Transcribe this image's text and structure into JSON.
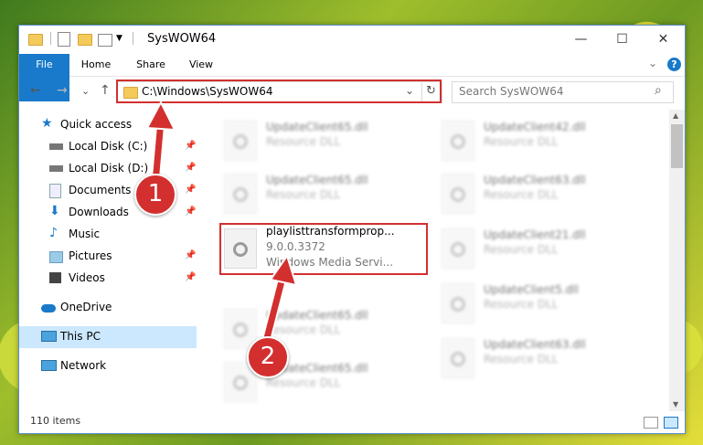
{
  "window": {
    "title": "SysWOW64",
    "minimize_label": "—",
    "maximize_label": "☐",
    "close_label": "✕"
  },
  "ribbon": {
    "tabs": [
      "File",
      "Home",
      "Share",
      "View"
    ],
    "help": "?",
    "collapse": "⌄"
  },
  "nav": {
    "back": "←",
    "forward": "→",
    "recent": "⌄",
    "up": "↑",
    "address": "C:\\Windows\\SysWOW64",
    "address_dropdown": "⌄",
    "refresh": "↻",
    "search_placeholder": "Search SysWOW64",
    "search_icon": "⌕"
  },
  "sidebar": {
    "items": [
      {
        "label": "Quick access",
        "icon": "star-icon"
      },
      {
        "label": "Local Disk (C:)",
        "icon": "drive-icon"
      },
      {
        "label": "Local Disk (D:)",
        "icon": "drive-icon"
      },
      {
        "label": "Documents",
        "icon": "documents-icon"
      },
      {
        "label": "Downloads",
        "icon": "download-icon"
      },
      {
        "label": "Music",
        "icon": "music-icon"
      },
      {
        "label": "Pictures",
        "icon": "pictures-icon"
      },
      {
        "label": "Videos",
        "icon": "videos-icon"
      },
      {
        "label": "OneDrive",
        "icon": "cloud-icon"
      },
      {
        "label": "This PC",
        "icon": "computer-icon"
      },
      {
        "label": "Network",
        "icon": "network-icon"
      }
    ]
  },
  "files": {
    "left": [
      {
        "name": "UpdateClient65.dll",
        "type": "Resource DLL"
      },
      {
        "name": "UpdateClient65.dll",
        "type": "Resource DLL"
      },
      {
        "name": "playlisttransformprop...",
        "version": "9.0.0.3372",
        "desc": "Windows Media Servi..."
      },
      {
        "name": "UpdateClient65.dll",
        "type": "Resource DLL"
      },
      {
        "name": "UpdateClient65.dll",
        "type": "Resource DLL"
      }
    ],
    "right": [
      {
        "name": "UpdateClient42.dll",
        "type": "Resource DLL"
      },
      {
        "name": "UpdateClient63.dll",
        "type": "Resource DLL"
      },
      {
        "name": "UpdateClient21.dll",
        "type": "Resource DLL"
      },
      {
        "name": "UpdateClient5.dll",
        "type": "Resource DLL"
      },
      {
        "name": "UpdateClient63.dll",
        "type": "Resource DLL"
      }
    ]
  },
  "status": {
    "count": "110 items"
  },
  "annotations": {
    "step1": "1",
    "step2": "2"
  },
  "colors": {
    "accent": "#1979ca",
    "highlight": "#d32f2f",
    "selected": "#cce8ff"
  }
}
